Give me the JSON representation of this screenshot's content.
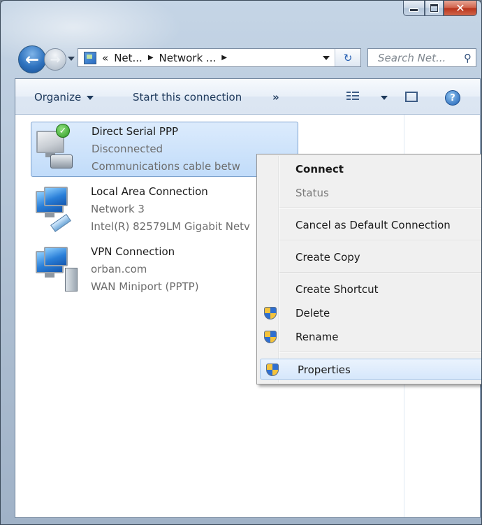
{
  "address": {
    "segment1": "Net...",
    "segment2": "Network ...",
    "prefix": "«"
  },
  "search": {
    "placeholder": "Search Net..."
  },
  "toolbar": {
    "organize": "Organize",
    "start": "Start this connection",
    "more": "»"
  },
  "connections": [
    {
      "name": "Direct Serial PPP",
      "status": "Disconnected",
      "device": "Communications cable betw"
    },
    {
      "name": "Local Area Connection",
      "status": "Network 3",
      "device": "Intel(R) 82579LM Gigabit Netv"
    },
    {
      "name": "VPN Connection",
      "status": "orban.com",
      "device": "WAN Miniport (PPTP)"
    }
  ],
  "context_menu": {
    "connect": "Connect",
    "status": "Status",
    "cancel_default": "Cancel as Default Connection",
    "create_copy": "Create Copy",
    "create_shortcut": "Create Shortcut",
    "delete": "Delete",
    "rename": "Rename",
    "properties": "Properties"
  },
  "icons": {
    "back": "back-arrow-icon",
    "forward": "forward-arrow-icon",
    "refresh": "refresh-icon",
    "search": "magnifier-icon",
    "help": "help-icon",
    "uac": "uac-shield-icon"
  }
}
